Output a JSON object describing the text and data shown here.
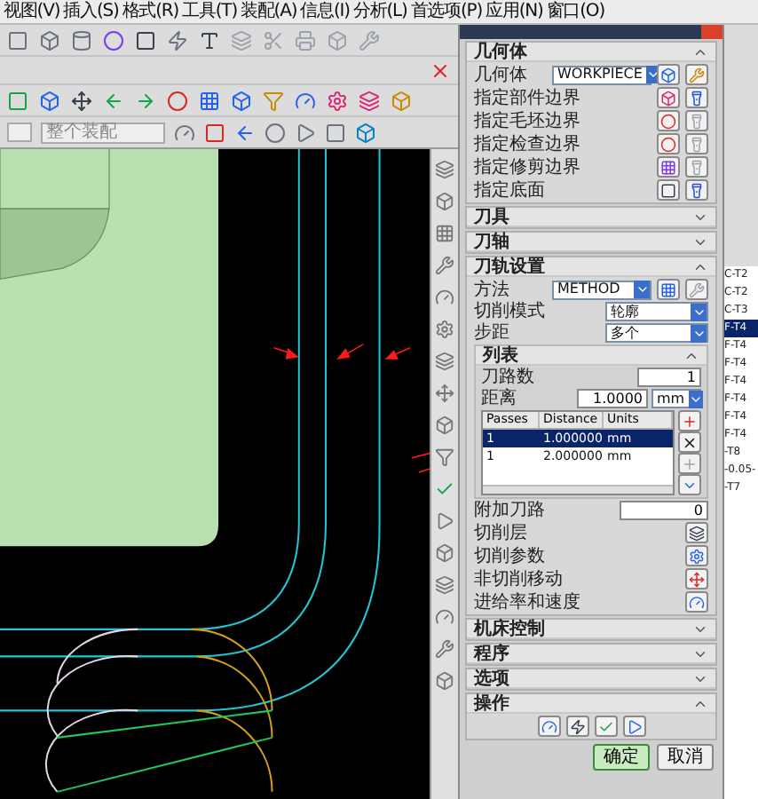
{
  "menu": [
    "视图(V)",
    "插入(S)",
    "格式(R)",
    "工具(T)",
    "装配(A)",
    "信息(I)",
    "分析(L)",
    "首选项(P)",
    "应用(N)",
    "窗口(O)"
  ],
  "assembly_field": {
    "value": "整个装配"
  },
  "dialog": {
    "sections": [
      {
        "kind": "geometry",
        "title": "几何体",
        "expanded": true,
        "geometry": {
          "label": "几何体",
          "value": "WORKPIECE"
        },
        "specs": [
          "指定部件边界",
          "指定毛坯边界",
          "指定检查边界",
          "指定修剪边界",
          "指定底面"
        ]
      },
      {
        "kind": "plain",
        "title": "刀具",
        "expanded": false
      },
      {
        "kind": "plain",
        "title": "刀轴",
        "expanded": false
      },
      {
        "kind": "path",
        "title": "刀轨设置",
        "expanded": true,
        "method": {
          "label": "方法",
          "value": "METHOD"
        },
        "cut_mode": {
          "label": "切削模式",
          "value": "轮廓"
        },
        "stepover": {
          "label": "步距",
          "value": "多个"
        },
        "list": {
          "title": "列表",
          "expanded": true,
          "passes": {
            "label": "刀路数",
            "value": "1"
          },
          "distance": {
            "label": "距离",
            "value": "1.0000",
            "unit": "mm"
          },
          "columns": [
            "Passes",
            "Distance",
            "Units"
          ],
          "rows": [
            {
              "cells": [
                "1",
                "1.000000",
                "mm"
              ],
              "selected": true
            },
            {
              "cells": [
                "1",
                "2.000000",
                "mm"
              ],
              "selected": false
            }
          ]
        },
        "extra": {
          "label": "附加刀路",
          "value": "0"
        },
        "actions": [
          "切削层",
          "切削参数",
          "非切削移动",
          "进给率和速度"
        ]
      },
      {
        "kind": "plain",
        "title": "机床控制",
        "expanded": false
      },
      {
        "kind": "plain",
        "title": "程序",
        "expanded": false
      },
      {
        "kind": "plain",
        "title": "选项",
        "expanded": false
      },
      {
        "kind": "ops",
        "title": "操作",
        "expanded": true
      }
    ],
    "buttons": [
      {
        "label": "确定",
        "default": true
      },
      {
        "label": "取消",
        "default": false
      }
    ]
  },
  "side_list": [
    {
      "text": "C-T2",
      "selected": false
    },
    {
      "text": "C-T2",
      "selected": false
    },
    {
      "text": "C-T3",
      "selected": false
    },
    {
      "text": "F-T4",
      "selected": true
    },
    {
      "text": "F-T4",
      "selected": false
    },
    {
      "text": "F-T4",
      "selected": false
    },
    {
      "text": "F-T4",
      "selected": false
    },
    {
      "text": "F-T4",
      "selected": false
    },
    {
      "text": "F-T4",
      "selected": false
    },
    {
      "text": "F-T4",
      "selected": false
    },
    {
      "text": "-T8",
      "selected": false
    },
    {
      "text": "-0.05-",
      "selected": false
    },
    {
      "text": "-T7",
      "selected": false
    }
  ]
}
